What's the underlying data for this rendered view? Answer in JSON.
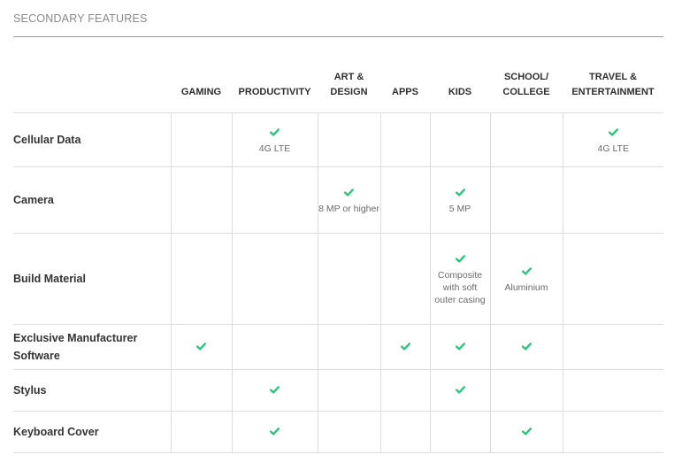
{
  "section": {
    "title": "SECONDARY FEATURES"
  },
  "colors": {
    "check": "#2ec27e",
    "rule": "#9a9a9a",
    "grid": "#dcdcdc"
  },
  "icons": {
    "check": "check-icon"
  },
  "columns": [
    {
      "id": "gaming",
      "label": "GAMING"
    },
    {
      "id": "productivity",
      "label": "PRODUCTIVITY"
    },
    {
      "id": "art_design",
      "label": "ART & DESIGN"
    },
    {
      "id": "apps",
      "label": "APPS"
    },
    {
      "id": "kids",
      "label": "KIDS"
    },
    {
      "id": "school_college",
      "label": "SCHOOL/ COLLEGE"
    },
    {
      "id": "travel_entertainment",
      "label": "TRAVEL & ENTERTAINMENT"
    }
  ],
  "rows": [
    {
      "feature": "Cellular Data",
      "cells": [
        {
          "check": false,
          "note": ""
        },
        {
          "check": true,
          "note": "4G LTE"
        },
        {
          "check": false,
          "note": ""
        },
        {
          "check": false,
          "note": ""
        },
        {
          "check": false,
          "note": ""
        },
        {
          "check": false,
          "note": ""
        },
        {
          "check": true,
          "note": "4G LTE"
        }
      ]
    },
    {
      "feature": "Camera",
      "cells": [
        {
          "check": false,
          "note": ""
        },
        {
          "check": false,
          "note": ""
        },
        {
          "check": true,
          "note": "8 MP or higher"
        },
        {
          "check": false,
          "note": ""
        },
        {
          "check": true,
          "note": "5 MP"
        },
        {
          "check": false,
          "note": ""
        },
        {
          "check": false,
          "note": ""
        }
      ]
    },
    {
      "feature": "Build Material",
      "cells": [
        {
          "check": false,
          "note": ""
        },
        {
          "check": false,
          "note": ""
        },
        {
          "check": false,
          "note": ""
        },
        {
          "check": false,
          "note": ""
        },
        {
          "check": true,
          "note": "Composite with soft outer casing"
        },
        {
          "check": true,
          "note": "Aluminium"
        },
        {
          "check": false,
          "note": ""
        }
      ]
    },
    {
      "feature": "Exclusive Manufacturer Software",
      "cells": [
        {
          "check": true,
          "note": ""
        },
        {
          "check": false,
          "note": ""
        },
        {
          "check": false,
          "note": ""
        },
        {
          "check": true,
          "note": ""
        },
        {
          "check": true,
          "note": ""
        },
        {
          "check": true,
          "note": ""
        },
        {
          "check": false,
          "note": ""
        }
      ]
    },
    {
      "feature": "Stylus",
      "cells": [
        {
          "check": false,
          "note": ""
        },
        {
          "check": true,
          "note": ""
        },
        {
          "check": false,
          "note": ""
        },
        {
          "check": false,
          "note": ""
        },
        {
          "check": true,
          "note": ""
        },
        {
          "check": false,
          "note": ""
        },
        {
          "check": false,
          "note": ""
        }
      ]
    },
    {
      "feature": "Keyboard Cover",
      "cells": [
        {
          "check": false,
          "note": ""
        },
        {
          "check": true,
          "note": ""
        },
        {
          "check": false,
          "note": ""
        },
        {
          "check": false,
          "note": ""
        },
        {
          "check": false,
          "note": ""
        },
        {
          "check": true,
          "note": ""
        },
        {
          "check": false,
          "note": ""
        }
      ]
    }
  ]
}
